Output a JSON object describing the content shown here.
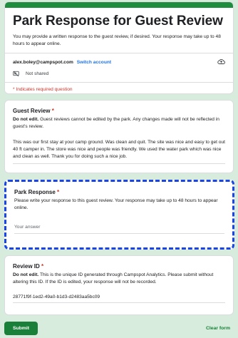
{
  "form": {
    "title": "Park Response for Guest Review",
    "description": "You may provide a written response to the guest review, if desired. Your response may take up to 48 hours to appear online.",
    "account_email": "alex.boley@campspot.com",
    "switch_account": "Switch account",
    "not_shared": "Not shared",
    "required_note": "* Indicates required question",
    "icons": {
      "cloud": "cloud-icon",
      "not_shared": "not-shared-icon"
    }
  },
  "guest_review": {
    "label": "Guest Review",
    "required_mark": "*",
    "note_bold": "Do not edit.",
    "note_text": " Guest reviews cannot be edited by the park. Any changes made will not be reflected in guest's review.",
    "review_text": "This was our first stay at your camp ground. Was clean and quit. The site was nice and easy to get out 40 ft camper in. The store was nice and people was friendly. We used the water park which was nice and clean as well. Thank you for doing such a nice job."
  },
  "park_response": {
    "label": "Park Response",
    "required_mark": "*",
    "note": "Please write your response to this guest review. Your response may take up to 48 hours to appear online.",
    "placeholder": "Your answer",
    "value": ""
  },
  "review_id": {
    "label": "Review ID",
    "required_mark": "*",
    "note_bold": "Do not edit.",
    "note_text": " This is the unique ID generated through Campspot Analytics. Please submit without altering this ID. If the ID is edited, your response will not be recorded.",
    "value": "28771f9f-1ed2-49a0-b1d3-d2483aa5bc09"
  },
  "footer": {
    "submit": "Submit",
    "clear": "Clear form"
  },
  "colors": {
    "accent": "#1e8e3e",
    "background": "#d8ecdd",
    "required": "#d93025",
    "link": "#1a73e8",
    "focus_outline": "#1a45e6"
  }
}
